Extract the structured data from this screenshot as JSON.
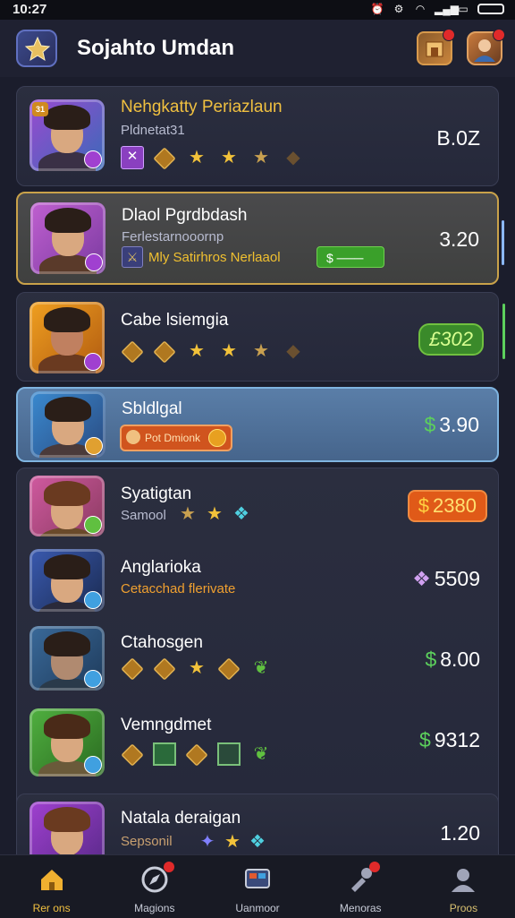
{
  "status_bar": {
    "time": "10:27"
  },
  "header": {
    "title": "Sojahto Umdan"
  },
  "cards": [
    {
      "name": "Nehgkatty Periazlaun",
      "subtitle": "Pldnetat31",
      "price": "B.0Z",
      "avatar_level": "31"
    },
    {
      "name": "Dlaol Pgrdbdash",
      "subtitle": "Ferlestarnooornp",
      "special_text": "Mly Satirhros Nerlaaol",
      "action_label": "$",
      "price": "3.20"
    },
    {
      "name": "Cabe lsiemgia",
      "price": "£302"
    },
    {
      "name": "Sbldlgal",
      "tag_label": "Pot Dmionk",
      "price_currency": "$",
      "price": "3.90"
    },
    {
      "name": "Syatigtan",
      "subtitle": "Samool",
      "price_currency": "$",
      "price": "2380"
    },
    {
      "name": "Anglarioka",
      "subtitle": "Cetacchad flerivate",
      "price": "5509"
    },
    {
      "name": "Ctahosgen",
      "price_currency": "$",
      "price": "8.00"
    },
    {
      "name": "Vemngdmet",
      "price_currency": "$",
      "price": "9312"
    },
    {
      "name": "Natala deraigan",
      "subtitle": "Sepsonil",
      "price": "1.20"
    }
  ],
  "nav": [
    {
      "label": "Rer ons",
      "icon": "home-icon",
      "active": true
    },
    {
      "label": "Magions",
      "icon": "compass-icon"
    },
    {
      "label": "Uanmoor",
      "icon": "screen-icon"
    },
    {
      "label": "Menoras",
      "icon": "tools-icon"
    },
    {
      "label": "Proos",
      "icon": "profile-icon"
    }
  ],
  "colors": {
    "accent_gold": "#c9a24a",
    "accent_green": "#5cd05c",
    "active_nav": "#f0c040"
  }
}
